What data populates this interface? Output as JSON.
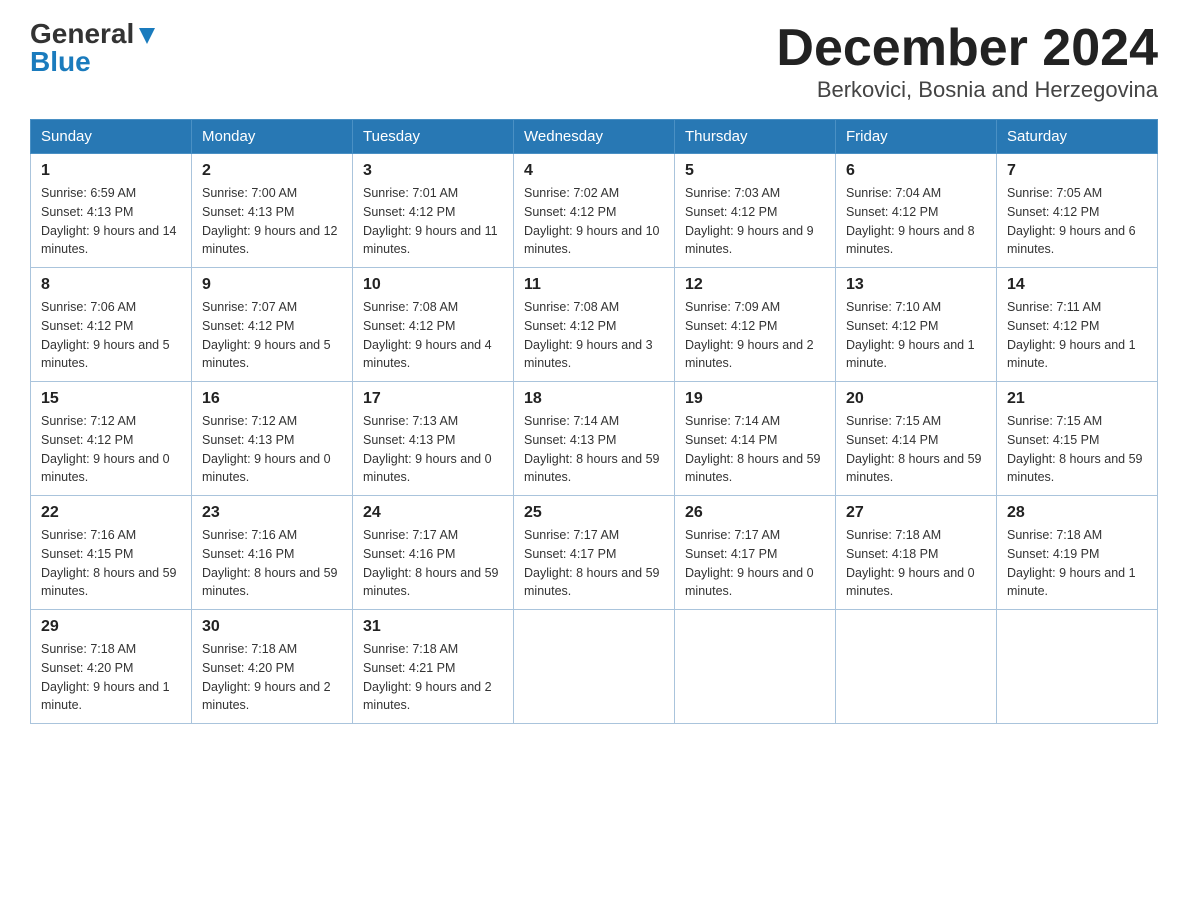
{
  "header": {
    "logo_general": "General",
    "logo_blue": "Blue",
    "title": "December 2024",
    "subtitle": "Berkovici, Bosnia and Herzegovina"
  },
  "days_of_week": [
    "Sunday",
    "Monday",
    "Tuesday",
    "Wednesday",
    "Thursday",
    "Friday",
    "Saturday"
  ],
  "weeks": [
    [
      {
        "day": "1",
        "sunrise": "6:59 AM",
        "sunset": "4:13 PM",
        "daylight": "9 hours and 14 minutes."
      },
      {
        "day": "2",
        "sunrise": "7:00 AM",
        "sunset": "4:13 PM",
        "daylight": "9 hours and 12 minutes."
      },
      {
        "day": "3",
        "sunrise": "7:01 AM",
        "sunset": "4:12 PM",
        "daylight": "9 hours and 11 minutes."
      },
      {
        "day": "4",
        "sunrise": "7:02 AM",
        "sunset": "4:12 PM",
        "daylight": "9 hours and 10 minutes."
      },
      {
        "day": "5",
        "sunrise": "7:03 AM",
        "sunset": "4:12 PM",
        "daylight": "9 hours and 9 minutes."
      },
      {
        "day": "6",
        "sunrise": "7:04 AM",
        "sunset": "4:12 PM",
        "daylight": "9 hours and 8 minutes."
      },
      {
        "day": "7",
        "sunrise": "7:05 AM",
        "sunset": "4:12 PM",
        "daylight": "9 hours and 6 minutes."
      }
    ],
    [
      {
        "day": "8",
        "sunrise": "7:06 AM",
        "sunset": "4:12 PM",
        "daylight": "9 hours and 5 minutes."
      },
      {
        "day": "9",
        "sunrise": "7:07 AM",
        "sunset": "4:12 PM",
        "daylight": "9 hours and 5 minutes."
      },
      {
        "day": "10",
        "sunrise": "7:08 AM",
        "sunset": "4:12 PM",
        "daylight": "9 hours and 4 minutes."
      },
      {
        "day": "11",
        "sunrise": "7:08 AM",
        "sunset": "4:12 PM",
        "daylight": "9 hours and 3 minutes."
      },
      {
        "day": "12",
        "sunrise": "7:09 AM",
        "sunset": "4:12 PM",
        "daylight": "9 hours and 2 minutes."
      },
      {
        "day": "13",
        "sunrise": "7:10 AM",
        "sunset": "4:12 PM",
        "daylight": "9 hours and 1 minute."
      },
      {
        "day": "14",
        "sunrise": "7:11 AM",
        "sunset": "4:12 PM",
        "daylight": "9 hours and 1 minute."
      }
    ],
    [
      {
        "day": "15",
        "sunrise": "7:12 AM",
        "sunset": "4:12 PM",
        "daylight": "9 hours and 0 minutes."
      },
      {
        "day": "16",
        "sunrise": "7:12 AM",
        "sunset": "4:13 PM",
        "daylight": "9 hours and 0 minutes."
      },
      {
        "day": "17",
        "sunrise": "7:13 AM",
        "sunset": "4:13 PM",
        "daylight": "9 hours and 0 minutes."
      },
      {
        "day": "18",
        "sunrise": "7:14 AM",
        "sunset": "4:13 PM",
        "daylight": "8 hours and 59 minutes."
      },
      {
        "day": "19",
        "sunrise": "7:14 AM",
        "sunset": "4:14 PM",
        "daylight": "8 hours and 59 minutes."
      },
      {
        "day": "20",
        "sunrise": "7:15 AM",
        "sunset": "4:14 PM",
        "daylight": "8 hours and 59 minutes."
      },
      {
        "day": "21",
        "sunrise": "7:15 AM",
        "sunset": "4:15 PM",
        "daylight": "8 hours and 59 minutes."
      }
    ],
    [
      {
        "day": "22",
        "sunrise": "7:16 AM",
        "sunset": "4:15 PM",
        "daylight": "8 hours and 59 minutes."
      },
      {
        "day": "23",
        "sunrise": "7:16 AM",
        "sunset": "4:16 PM",
        "daylight": "8 hours and 59 minutes."
      },
      {
        "day": "24",
        "sunrise": "7:17 AM",
        "sunset": "4:16 PM",
        "daylight": "8 hours and 59 minutes."
      },
      {
        "day": "25",
        "sunrise": "7:17 AM",
        "sunset": "4:17 PM",
        "daylight": "8 hours and 59 minutes."
      },
      {
        "day": "26",
        "sunrise": "7:17 AM",
        "sunset": "4:17 PM",
        "daylight": "9 hours and 0 minutes."
      },
      {
        "day": "27",
        "sunrise": "7:18 AM",
        "sunset": "4:18 PM",
        "daylight": "9 hours and 0 minutes."
      },
      {
        "day": "28",
        "sunrise": "7:18 AM",
        "sunset": "4:19 PM",
        "daylight": "9 hours and 1 minute."
      }
    ],
    [
      {
        "day": "29",
        "sunrise": "7:18 AM",
        "sunset": "4:20 PM",
        "daylight": "9 hours and 1 minute."
      },
      {
        "day": "30",
        "sunrise": "7:18 AM",
        "sunset": "4:20 PM",
        "daylight": "9 hours and 2 minutes."
      },
      {
        "day": "31",
        "sunrise": "7:18 AM",
        "sunset": "4:21 PM",
        "daylight": "9 hours and 2 minutes."
      },
      null,
      null,
      null,
      null
    ]
  ],
  "sunrise_label": "Sunrise: ",
  "sunset_label": "Sunset: ",
  "daylight_label": "Daylight: "
}
